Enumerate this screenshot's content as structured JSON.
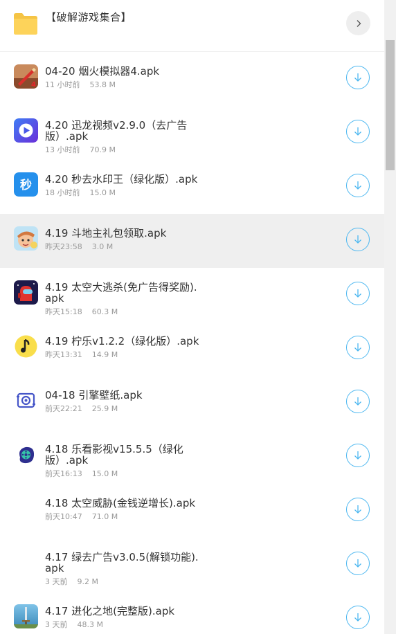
{
  "header": {
    "title": "【破解游戏集合】",
    "folder_color": "#f5c445"
  },
  "files": [
    {
      "name": "04-20 烟火模拟器4.apk",
      "time": "11 小时前",
      "size": "53.8 M",
      "icon": "fireworks-icon"
    },
    {
      "name": "4.20 迅龙视频v2.9.0（去广告版）.apk",
      "time": "13 小时前",
      "size": "70.9 M",
      "icon": "play-icon"
    },
    {
      "name": "4.20 秒去水印王（绿化版）.apk",
      "time": "18 小时前",
      "size": "15.0 M",
      "icon": "miao-icon",
      "icon_text": "秒"
    },
    {
      "name": "4.19 斗地主礼包领取.apk",
      "time": "昨天23:58",
      "size": "3.0 M",
      "icon": "cartoon-face-icon"
    },
    {
      "name": "4.19 太空大逃杀(免广告得奖励).apk",
      "time": "昨天15:18",
      "size": "60.3 M",
      "icon": "space-crew-icon"
    },
    {
      "name": "4.19 柠乐v1.2.2（绿化版）.apk",
      "time": "昨天13:31",
      "size": "14.9 M",
      "icon": "music-note-icon"
    },
    {
      "name": "04-18 引擎壁纸.apk",
      "time": "前天22:21",
      "size": "25.9 M",
      "icon": "gear-icon"
    },
    {
      "name": "4.18 乐看影视v15.5.5（绿化版）.apk",
      "time": "前天16:13",
      "size": "15.0 M",
      "icon": "film-reel-icon"
    },
    {
      "name": "4.18 太空威胁(金钱逆增长).apk",
      "time": "前天10:47",
      "size": "71.0 M",
      "icon": "blank-icon"
    },
    {
      "name": "4.17 绿去广告v3.0.5(解锁功能).apk",
      "time": "3 天前",
      "size": "9.2 M",
      "icon": "blank-icon"
    },
    {
      "name": "4.17 进化之地(完整版).apk",
      "time": "3 天前",
      "size": "48.3 M",
      "icon": "sword-icon"
    }
  ],
  "accent_color": "#4cb7f0"
}
